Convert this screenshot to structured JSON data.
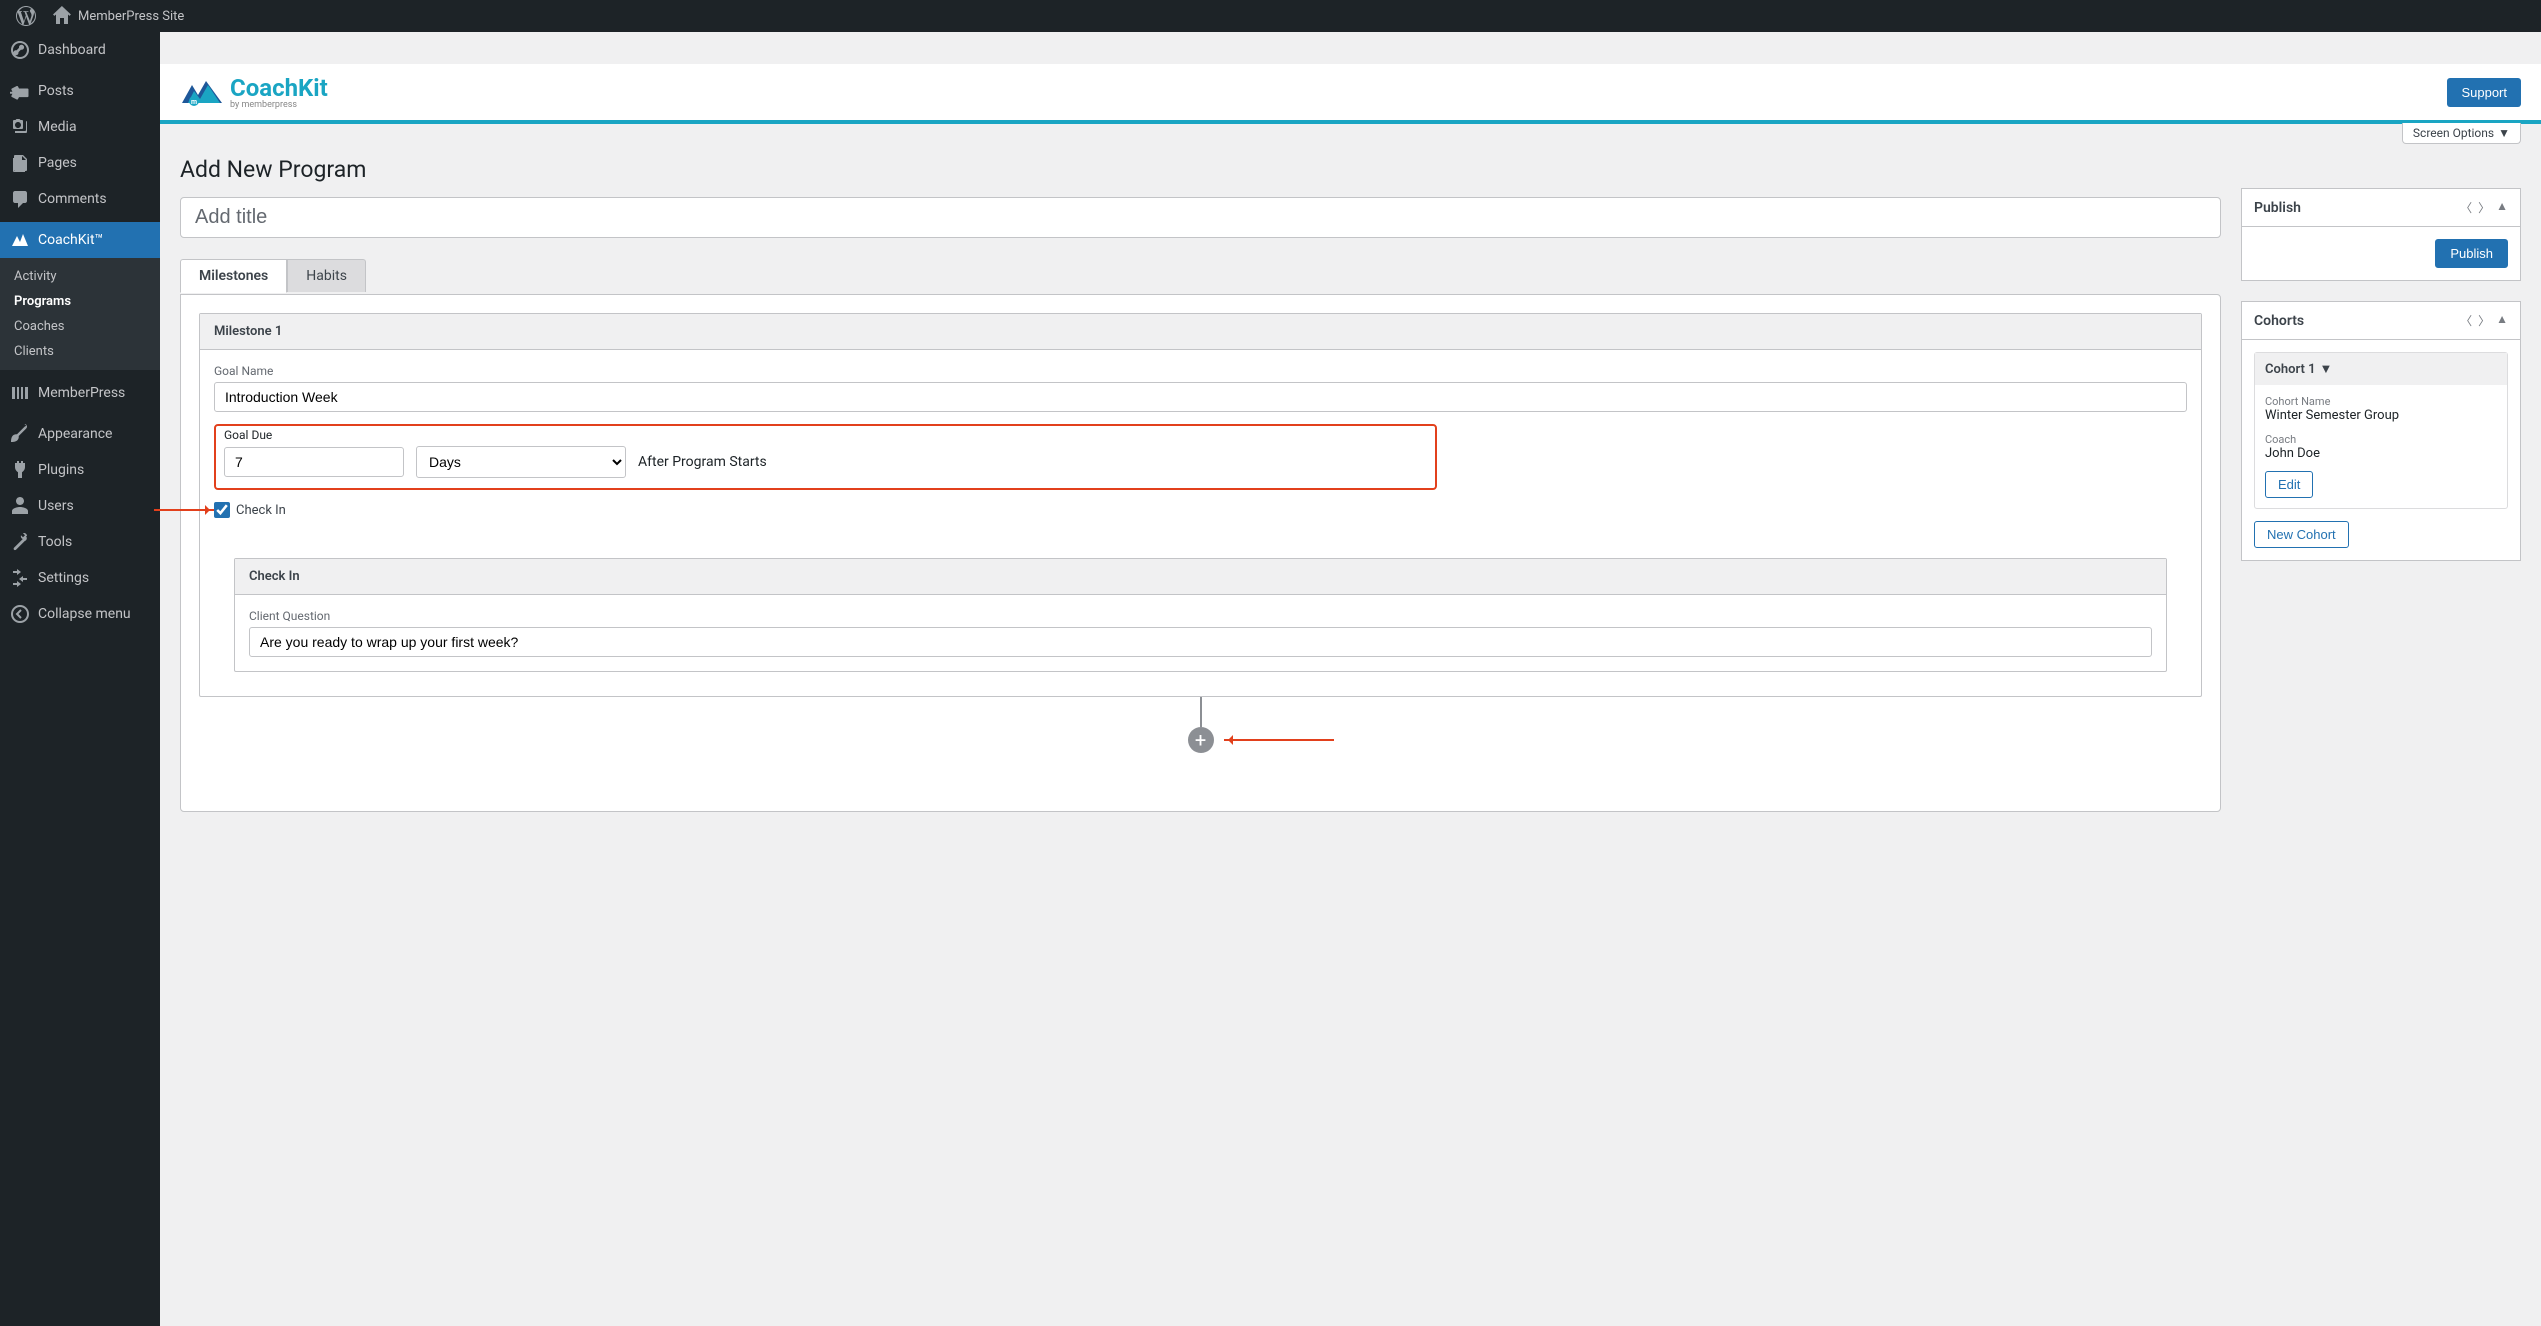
{
  "adminbar": {
    "site_name": "MemberPress Site"
  },
  "sidebar": {
    "items": [
      {
        "label": "Dashboard"
      },
      {
        "label": "Posts"
      },
      {
        "label": "Media"
      },
      {
        "label": "Pages"
      },
      {
        "label": "Comments"
      },
      {
        "label": "CoachKit™"
      },
      {
        "label": "MemberPress"
      },
      {
        "label": "Appearance"
      },
      {
        "label": "Plugins"
      },
      {
        "label": "Users"
      },
      {
        "label": "Tools"
      },
      {
        "label": "Settings"
      },
      {
        "label": "Collapse menu"
      }
    ],
    "coachkit_sub": [
      {
        "label": "Activity"
      },
      {
        "label": "Programs"
      },
      {
        "label": "Coaches"
      },
      {
        "label": "Clients"
      }
    ]
  },
  "topband": {
    "logo_main": "CoachKit",
    "logo_sub": "by memberpress",
    "support_btn": "Support"
  },
  "screen_options": "Screen Options",
  "page_title": "Add New Program",
  "title_placeholder": "Add title",
  "tabs": {
    "milestones": "Milestones",
    "habits": "Habits"
  },
  "milestone": {
    "header": "Milestone 1",
    "goal_name_label": "Goal Name",
    "goal_name_value": "Introduction Week",
    "goal_due_label": "Goal Due",
    "goal_due_value": "7",
    "goal_due_unit": "Days",
    "goal_due_after": "After Program Starts",
    "checkin_label": "Check In"
  },
  "checkin": {
    "header": "Check In",
    "question_label": "Client Question",
    "question_value": "Are you ready to wrap up your first week?"
  },
  "publish": {
    "title": "Publish",
    "button": "Publish"
  },
  "cohorts": {
    "title": "Cohorts",
    "item_header": "Cohort 1",
    "name_label": "Cohort Name",
    "name_value": "Winter Semester Group",
    "coach_label": "Coach",
    "coach_value": "John Doe",
    "edit_btn": "Edit",
    "new_btn": "New Cohort"
  }
}
